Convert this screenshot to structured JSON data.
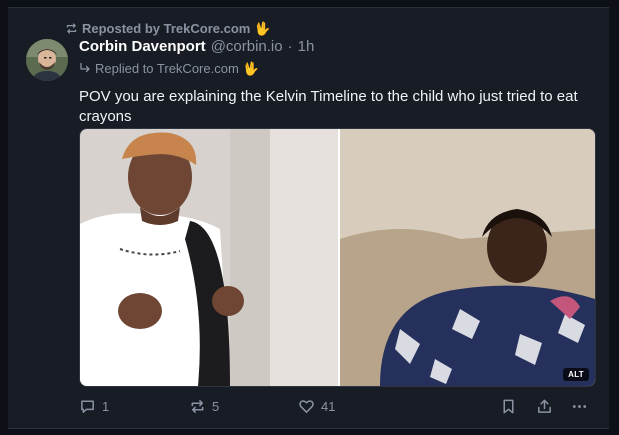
{
  "repost": {
    "label": "Reposted by TrekCore.com",
    "emoji": "🖖"
  },
  "post": {
    "author_name": "Corbin Davenport",
    "author_handle": "@corbin.io",
    "separator": "·",
    "time": "1h",
    "replied_to_label": "Replied to TrekCore.com",
    "replied_to_emoji": "🖖",
    "text": "POV you are explaining the Kelvin Timeline to the child who just tried to eat crayons",
    "media_alt_badge": "ALT"
  },
  "actions": {
    "reply_count": "1",
    "repost_count": "5",
    "like_count": "41"
  },
  "colors": {
    "background": "#181c24",
    "page": "#0d1117",
    "muted_text": "#8b93a3",
    "primary_text": "#f1f3f6"
  },
  "icons": [
    "repost-icon",
    "reply-arrow-icon",
    "reply-icon",
    "repost-icon",
    "like-icon",
    "bookmark-icon",
    "share-icon",
    "more-icon"
  ]
}
